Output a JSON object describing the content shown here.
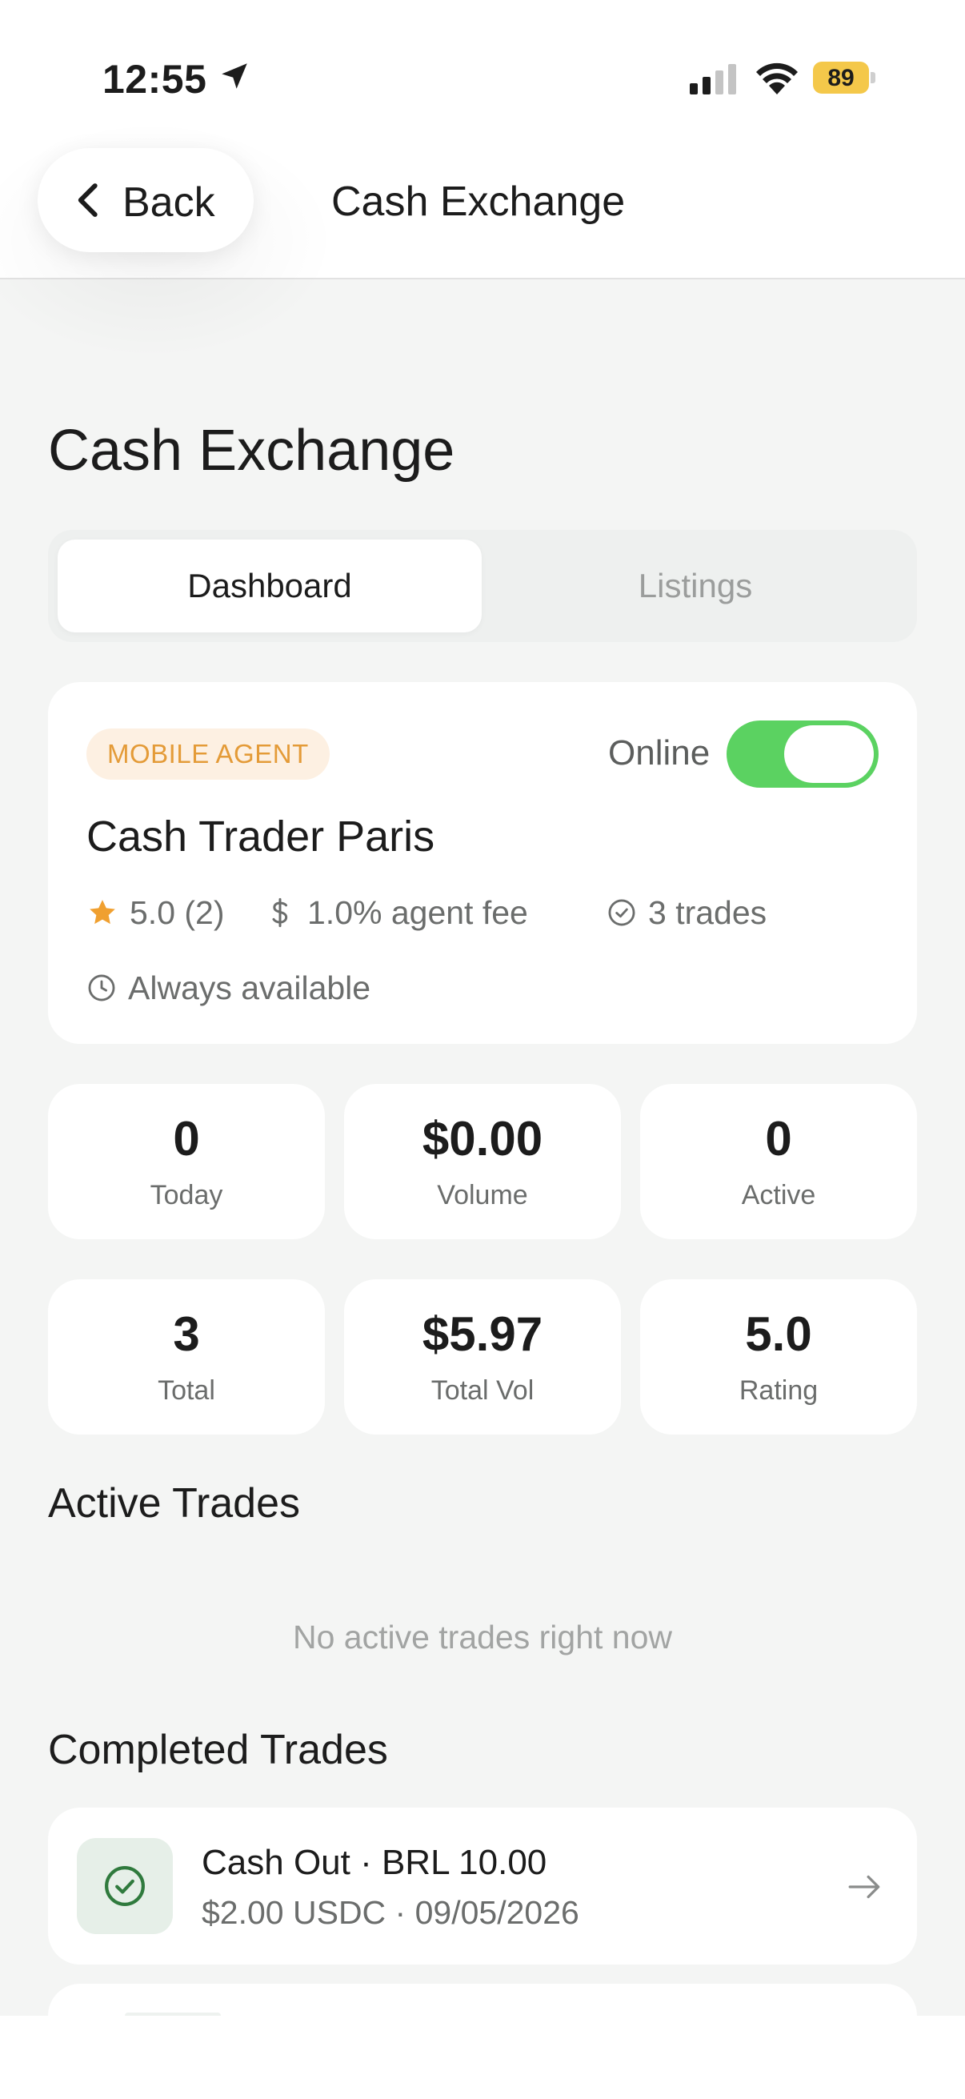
{
  "status_bar": {
    "time": "12:55",
    "battery": "89",
    "icons": [
      "location-arrow-icon",
      "cellular-signal-icon",
      "wifi-icon",
      "battery-icon"
    ]
  },
  "nav": {
    "back_label": "Back",
    "title": "Cash Exchange"
  },
  "page": {
    "title": "Cash Exchange"
  },
  "tabs": [
    {
      "label": "Dashboard",
      "active": true
    },
    {
      "label": "Listings",
      "active": false
    }
  ],
  "agent": {
    "badge": "MOBILE AGENT",
    "online_label": "Online",
    "online": true,
    "name": "Cash Trader Paris",
    "rating": "5.0 (2)",
    "fee": "1.0% agent fee",
    "trades": "3 trades",
    "availability": "Always available"
  },
  "stats": [
    {
      "value": "0",
      "label": "Today"
    },
    {
      "value": "$0.00",
      "label": "Volume"
    },
    {
      "value": "0",
      "label": "Active"
    },
    {
      "value": "3",
      "label": "Total"
    },
    {
      "value": "$5.97",
      "label": "Total Vol"
    },
    {
      "value": "5.0",
      "label": "Rating"
    }
  ],
  "active_trades": {
    "title": "Active Trades",
    "empty_message": "No active trades right now"
  },
  "completed_trades": {
    "title": "Completed Trades",
    "items": [
      {
        "title": "Cash Out · BRL 10.00",
        "subtitle": "$2.00 USDC · 09/05/2026"
      }
    ]
  },
  "colors": {
    "accent_green": "#5bd261",
    "badge_orange": "#e49b38",
    "star": "#f0a030",
    "success_icon": "#2f7a3d"
  }
}
